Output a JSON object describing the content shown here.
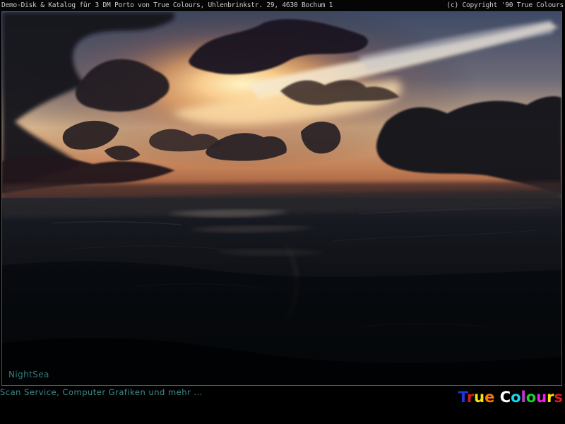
{
  "header": {
    "left_text": "Demo-Disk & Katalog für 3 DM Porto von True Colours, Uhlenbrinkstr. 29, 4630 Bochum 1",
    "right_text": "(c) Copyright '90 True Colours"
  },
  "photo": {
    "caption": "NightSea"
  },
  "footer": {
    "tagline": "Scan Service, Computer Grafiken und mehr ...",
    "logo_text": "True Colours",
    "logo_colors": [
      "#1f38d8",
      "#e01a1a",
      "#f4e60a",
      "#ff7a00",
      "#ffffff",
      "#19d5e8",
      "#c23ad8",
      "#1bd22a",
      "#f01df2",
      "#ffe500",
      "#e01a1a",
      "#20c060"
    ]
  }
}
